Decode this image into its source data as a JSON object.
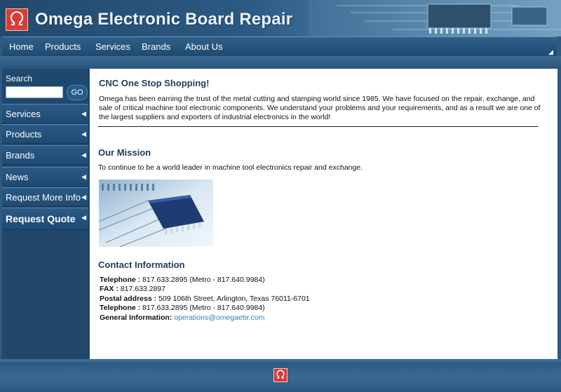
{
  "header": {
    "title": "Omega Electronic Board Repair",
    "logo_icon": "omega-logo-icon",
    "brand_color": "#d93b35"
  },
  "nav": {
    "items": [
      {
        "label": "Home"
      },
      {
        "label": "Products"
      },
      {
        "label": "Services"
      },
      {
        "label": "Brands"
      },
      {
        "label": "About Us"
      }
    ]
  },
  "sidebar": {
    "search_label": "Search",
    "search_value": "",
    "go_label": "GO",
    "items": [
      {
        "label": "Services"
      },
      {
        "label": "Products"
      },
      {
        "label": "Brands"
      },
      {
        "label": "News"
      },
      {
        "label": "Request More Info"
      },
      {
        "label": "Request Quote"
      }
    ]
  },
  "main": {
    "heading": "CNC One Stop Shopping!",
    "intro": "Omega has been earning the trust of the metal cutting and stamping world since 1985.  We have focused on the repair, exchange, and sale of critical machine tool electronic components.  We understand your problems and your requirements, and as a result we are one of the largest suppliers and exporters of industrial electronics in the world!",
    "mission_heading": "Our Mission",
    "mission_text": "To continue to be a world leader in machine tool electronics repair and exchange.",
    "contact_heading": "Contact Information",
    "contact": [
      {
        "label": "Telephone :",
        "value": " 817.633.2895  (Metro - 817.640.9984)"
      },
      {
        "label": "FAX :",
        "value": " 817.633.2897"
      },
      {
        "label": "Postal address :",
        "value": " 509 106th Street, Arlington, Texas 76011-6701"
      },
      {
        "label": "Telephone :",
        "value": " 817.633.2895  (Metro - 817.640.9984)"
      },
      {
        "label": "General Information:",
        "value": "",
        "link": "operations@omegaebr.com"
      }
    ]
  },
  "colors": {
    "link": "#2a7fc2",
    "heading": "#1c3d5c"
  }
}
